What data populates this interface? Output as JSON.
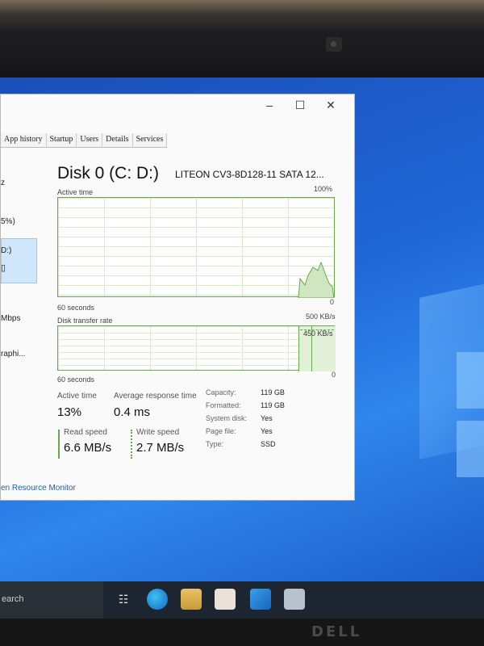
{
  "window": {
    "minimize": "–",
    "maximize": "☐",
    "close": "✕"
  },
  "tabs": [
    "App history",
    "Startup",
    "Users",
    "Details",
    "Services"
  ],
  "sidebar": [
    {
      "label": "z"
    },
    {
      "label": "5%)"
    },
    {
      "label": "D:)"
    },
    {
      "label": "Mbps"
    },
    {
      "label": "raphi..."
    }
  ],
  "disk": {
    "title": "Disk 0 (C: D:)",
    "model": "LITEON CV3-8D128-11 SATA 12...",
    "graph1_label": "Active time",
    "graph1_max": "100%",
    "graph1_duration": "60 seconds",
    "graph1_min": "0",
    "graph2_label": "Disk transfer rate",
    "graph2_max": "500 KB/s",
    "graph2_marker": "450 KB/s",
    "graph2_duration": "60 seconds",
    "graph2_min": "0"
  },
  "stats": {
    "active_time_label": "Active time",
    "active_time": "13%",
    "avg_response_label": "Average response time",
    "avg_response": "0.4 ms",
    "read_label": "Read speed",
    "read": "6.6 MB/s",
    "write_label": "Write speed",
    "write": "2.7 MB/s"
  },
  "details": [
    {
      "label": "Capacity:",
      "value": "119 GB"
    },
    {
      "label": "Formatted:",
      "value": "119 GB"
    },
    {
      "label": "System disk:",
      "value": "Yes"
    },
    {
      "label": "Page file:",
      "value": "Yes"
    },
    {
      "label": "Type:",
      "value": "SSD"
    }
  ],
  "footer": {
    "resource_monitor": "en Resource Monitor"
  },
  "taskbar": {
    "search_text": "earch",
    "icons": [
      "task-view-icon",
      "edge-icon",
      "file-explorer-icon",
      "store-icon",
      "mail-icon",
      "generic-app-icon"
    ]
  },
  "colors": {
    "graph_line": "#6aa84f",
    "desktop_blue": "#1f66d6"
  }
}
